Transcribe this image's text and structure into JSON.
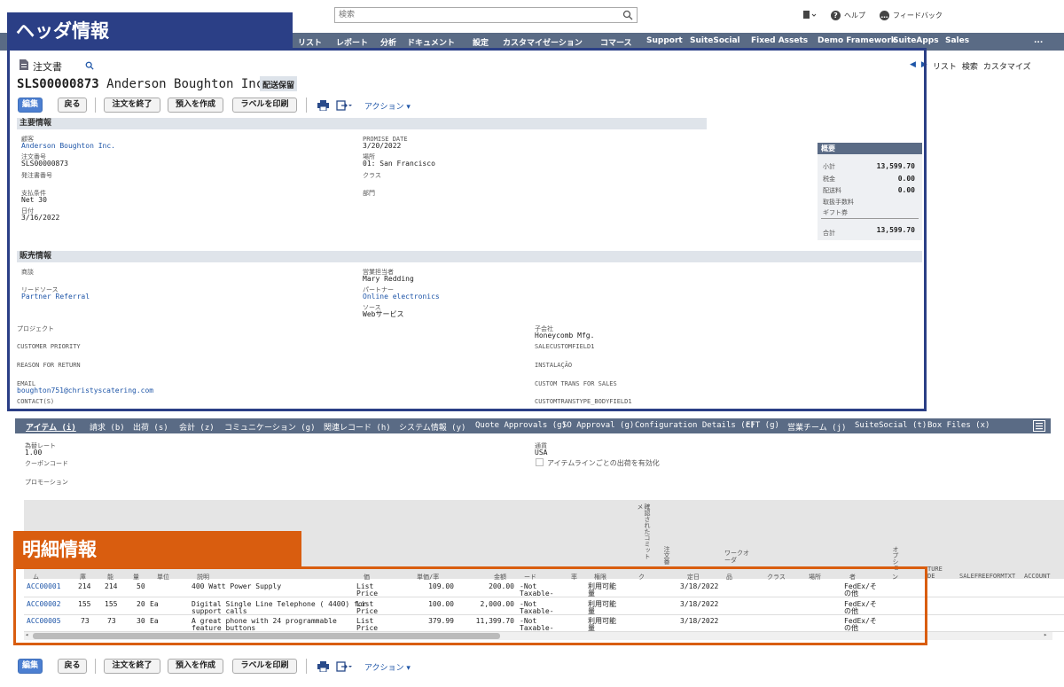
{
  "search": {
    "placeholder": "検索"
  },
  "topright": {
    "help": "ヘルプ",
    "feedback": "フィードバック"
  },
  "nav": [
    "リスト",
    "レポート",
    "分析",
    "ドキュメント",
    "設定",
    "カスタマイゼーション",
    "コマース",
    "Support",
    "SuiteSocial",
    "Fixed Assets",
    "Demo Framework",
    "SuiteApps",
    "Sales",
    "..."
  ],
  "callouts": {
    "header": "ヘッダ情報",
    "detail": "明細情報"
  },
  "record": {
    "type": "注文書",
    "id": "SLS00000873",
    "name": "Anderson Boughton Inc.",
    "status": "配送保留"
  },
  "pager": {
    "list": "リスト",
    "search": "検索",
    "customize": "カスタマイズ"
  },
  "buttons": {
    "edit": "編集",
    "back": "戻る",
    "close": "注文を終了",
    "deposit": "預入を作成",
    "label": "ラベルを印刷",
    "action": "アクション"
  },
  "primary": {
    "section": "主要情報",
    "customer_label": "顧客",
    "customer": "Anderson Boughton Inc.",
    "order_no_label": "注文番号",
    "order_no": "SLS00000873",
    "po_label": "発注書番号",
    "terms_label": "支払条件",
    "terms": "Net 30",
    "date_label": "日付",
    "date": "3/16/2022",
    "promise_label": "PROMISE DATE",
    "promise": "3/20/2022",
    "location_label": "場所",
    "location": "01: San Francisco",
    "class_label": "クラス",
    "dept_label": "部門"
  },
  "summary": {
    "title": "概要",
    "subtotal_label": "小計",
    "subtotal": "13,599.70",
    "tax_label": "税金",
    "tax": "0.00",
    "shipping_label": "配送料",
    "shipping": "0.00",
    "handling_label": "取扱手数料",
    "gift_label": "ギフト券",
    "total_label": "合計",
    "total": "13,599.70"
  },
  "sales": {
    "section": "販売情報",
    "opportunity_label": "商談",
    "rep_label": "営業担当者",
    "rep": "Mary Redding",
    "lead_label": "リードソース",
    "lead": "Partner Referral",
    "partner_label": "パートナー",
    "partner": "Online electronics",
    "source_label": "ソース",
    "source": "Webサービス",
    "project_label": "プロジェクト",
    "subsidiary_label": "子会社",
    "subsidiary": "Honeycomb Mfg.",
    "priority_label": "CUSTOMER PRIORITY",
    "salecf_label": "SALECUSTOMFIELD1",
    "reason_label": "REASON FOR RETURN",
    "install_label": "INSTALAÇÃO",
    "email_label": "EMAIL",
    "email": "boughton751@christyscatering.com",
    "ctrans_label": "CUSTOM TRANS FOR SALES",
    "contact_label": "CONTACT(S)",
    "body_label": "CUSTOMTRANSTYPE_BODYFIELD1"
  },
  "subtabs": [
    "アイテム (i)",
    "請求 (b)",
    "出荷 (s)",
    "会計 (z)",
    "コミュニケーション (g)",
    "関連レコード (h)",
    "システム情報 (y)",
    "Quote Approvals (g)",
    "SO Approval (g)",
    "Configuration Details (c)",
    "EFT (g)",
    "営業チーム (j)",
    "SuiteSocial (t)",
    "Box Files (x)"
  ],
  "items_form": {
    "rate_label": "為替レート",
    "rate": "1.00",
    "currency_label": "通貨",
    "currency": "USA",
    "coupon_label": "クーポンコード",
    "ship_line": "アイテムラインごとの出荷を有効化",
    "promo_label": "プロモーション"
  },
  "grid": {
    "vheaders": [
      "確認されたコミットメ",
      "注文番",
      "ワークオーダ",
      "オプショ"
    ],
    "headers": [
      "ム",
      "庫",
      "能",
      "量",
      "単位",
      "説明",
      "価",
      "単価/率",
      "金額",
      "ード",
      "率",
      "権限",
      "ク",
      "",
      "",
      "定日",
      "品",
      "クラス",
      "場所",
      "者",
      "ン",
      "",
      "TURE\nDE",
      "SALEFREEFORMTXT",
      "ACCOUNT"
    ],
    "rows": [
      {
        "item": "ACC00001",
        "a": "214",
        "b": "214",
        "qty": "50",
        "unit": "",
        "desc": "400 Watt Power Supply",
        "desc2": "",
        "price": "List",
        "price2": "Price",
        "rate": "109.00",
        "amount": "200.00",
        "tax": "-Not",
        "tax2": "Taxable-",
        "avail": "利用可能",
        "avail2": "量",
        "date": "3/18/2022",
        "ship": "FedEx/そ",
        "ship2": "の他"
      },
      {
        "item": "ACC00002",
        "a": "155",
        "b": "155",
        "qty": "20",
        "unit": "Ea",
        "desc": "Digital Single Line Telephone ( 4400) for",
        "desc2": "support calls",
        "price": "List",
        "price2": "Price",
        "rate": "100.00",
        "amount": "2,000.00",
        "tax": "-Not",
        "tax2": "Taxable-",
        "avail": "利用可能",
        "avail2": "量",
        "date": "3/18/2022",
        "ship": "FedEx/そ",
        "ship2": "の他"
      },
      {
        "item": "ACC00005",
        "a": "73",
        "b": "73",
        "qty": "30",
        "unit": "Ea",
        "desc": "A great phone with 24 programmable",
        "desc2": "feature buttons",
        "price": "List",
        "price2": "Price",
        "rate": "379.99",
        "amount": "11,399.70",
        "tax": "-Not",
        "tax2": "Taxable-",
        "avail": "利用可能",
        "avail2": "量",
        "date": "3/18/2022",
        "ship": "FedEx/そ",
        "ship2": "の他"
      }
    ]
  },
  "colors": {
    "nav": "#5a6b85",
    "header_callout": "#2b3f86",
    "detail_callout": "#d95d0f",
    "primary": "#4c7fd1"
  }
}
